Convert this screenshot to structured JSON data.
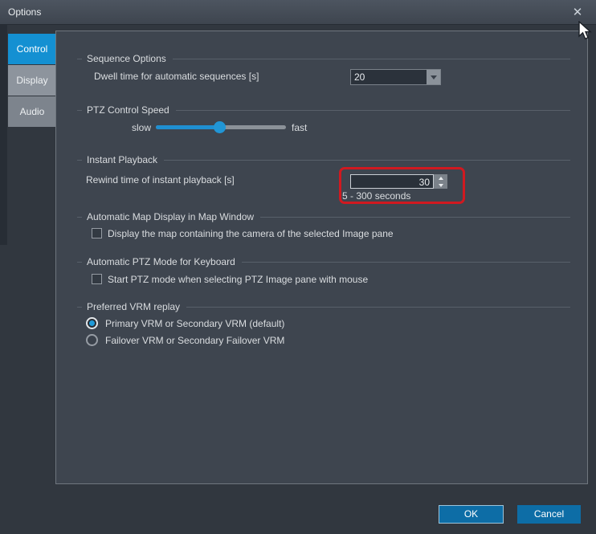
{
  "window": {
    "title": "Options",
    "close_glyph": "✕"
  },
  "colors": {
    "active_tab_blue": "#1490d2",
    "button_blue": "#0d6da6",
    "highlight_red": "#d01920",
    "slider_blue": "#1f8fd1"
  },
  "tabs": [
    {
      "label": "Control",
      "active": true
    },
    {
      "label": "Display",
      "active": false
    },
    {
      "label": "Audio",
      "active": false
    }
  ],
  "sections": {
    "sequence": {
      "title": "Sequence Options",
      "dwell_label": "Dwell time for automatic sequences [s]",
      "dwell_value": "20"
    },
    "ptz_speed": {
      "title": "PTZ Control Speed",
      "slow_label": "slow",
      "fast_label": "fast",
      "position_pct": 49
    },
    "instant_playback": {
      "title": "Instant Playback",
      "rewind_label": "Rewind time of instant playback [s]",
      "rewind_value": "30",
      "range_hint": "5 - 300 seconds"
    },
    "map_display": {
      "title": "Automatic Map Display in Map Window",
      "checkbox_label": "Display the map containing the camera of the selected Image pane",
      "checked": false
    },
    "ptz_keyboard": {
      "title": "Automatic PTZ Mode for Keyboard",
      "checkbox_label": "Start PTZ mode when selecting PTZ Image pane with mouse",
      "checked": false
    },
    "vrm": {
      "title": "Preferred VRM replay",
      "options": [
        {
          "label": "Primary VRM or Secondary VRM (default)",
          "selected": true
        },
        {
          "label": "Failover VRM or Secondary Failover VRM",
          "selected": false
        }
      ]
    }
  },
  "footer": {
    "ok_label": "OK",
    "cancel_label": "Cancel"
  }
}
